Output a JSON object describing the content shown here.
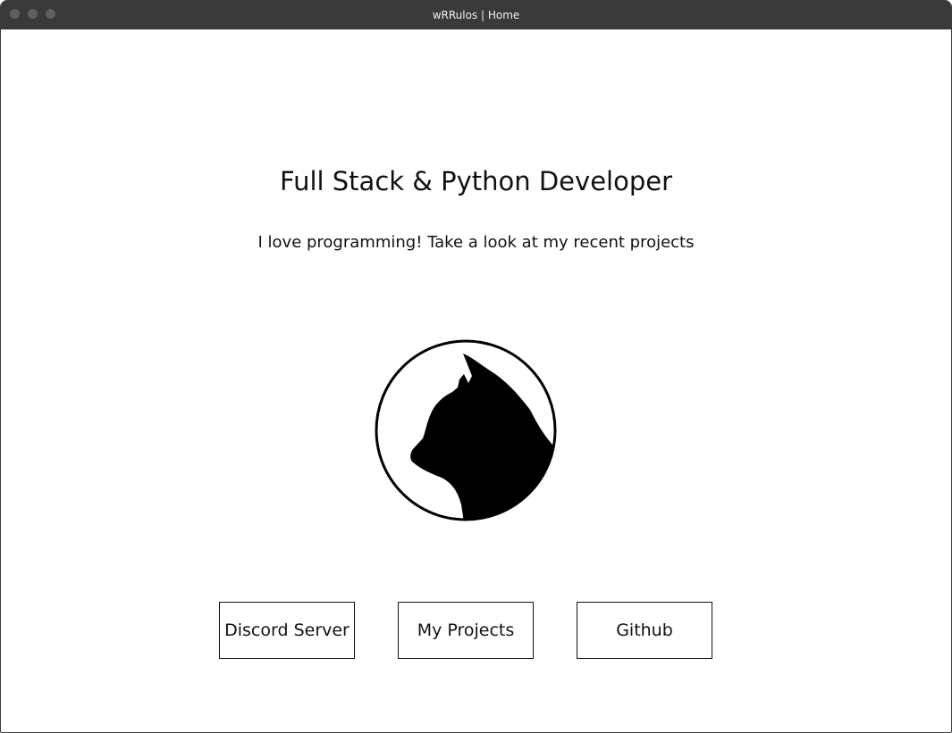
{
  "window": {
    "title": "wRRulos | Home"
  },
  "hero": {
    "headline": "Full Stack & Python Developer",
    "tagline": "I love programming! Take a look at my recent projects"
  },
  "logo": {
    "icon": "cat-silhouette-icon"
  },
  "buttons": [
    {
      "label": "Discord Server"
    },
    {
      "label": "My Projects"
    },
    {
      "label": "Github"
    }
  ],
  "colors": {
    "titlebar": "#3a3a3a",
    "text": "#111111",
    "background": "#ffffff"
  }
}
